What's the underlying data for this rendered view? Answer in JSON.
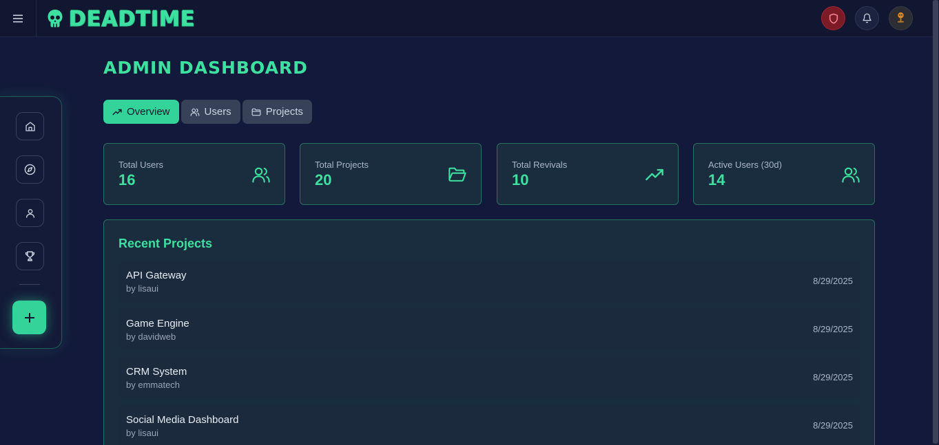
{
  "app": {
    "name": "DEADTIME"
  },
  "page": {
    "title": "ADMIN DASHBOARD"
  },
  "tabs": [
    {
      "label": "Overview",
      "icon": "trending-up-icon",
      "active": true
    },
    {
      "label": "Users",
      "icon": "users-icon",
      "active": false
    },
    {
      "label": "Projects",
      "icon": "folder-icon",
      "active": false
    }
  ],
  "stats": [
    {
      "label": "Total Users",
      "value": "16",
      "icon": "users-icon"
    },
    {
      "label": "Total Projects",
      "value": "20",
      "icon": "folder-open-icon"
    },
    {
      "label": "Total Revivals",
      "value": "10",
      "icon": "trending-up-icon"
    },
    {
      "label": "Active Users (30d)",
      "value": "14",
      "icon": "users-icon"
    }
  ],
  "recent_projects": {
    "title": "Recent Projects",
    "items": [
      {
        "name": "API Gateway",
        "by": "by lisaui",
        "date": "8/29/2025"
      },
      {
        "name": "Game Engine",
        "by": "by davidweb",
        "date": "8/29/2025"
      },
      {
        "name": "CRM System",
        "by": "by emmatech",
        "date": "8/29/2025"
      },
      {
        "name": "Social Media Dashboard",
        "by": "by lisaui",
        "date": "8/29/2025"
      }
    ]
  },
  "sidenav": [
    "home-icon",
    "compass-icon",
    "user-icon",
    "trophy-icon"
  ],
  "colors": {
    "accent": "#34d399",
    "background": "#13193a",
    "card": "#1a2d3e",
    "danger": "#7a1b25"
  }
}
